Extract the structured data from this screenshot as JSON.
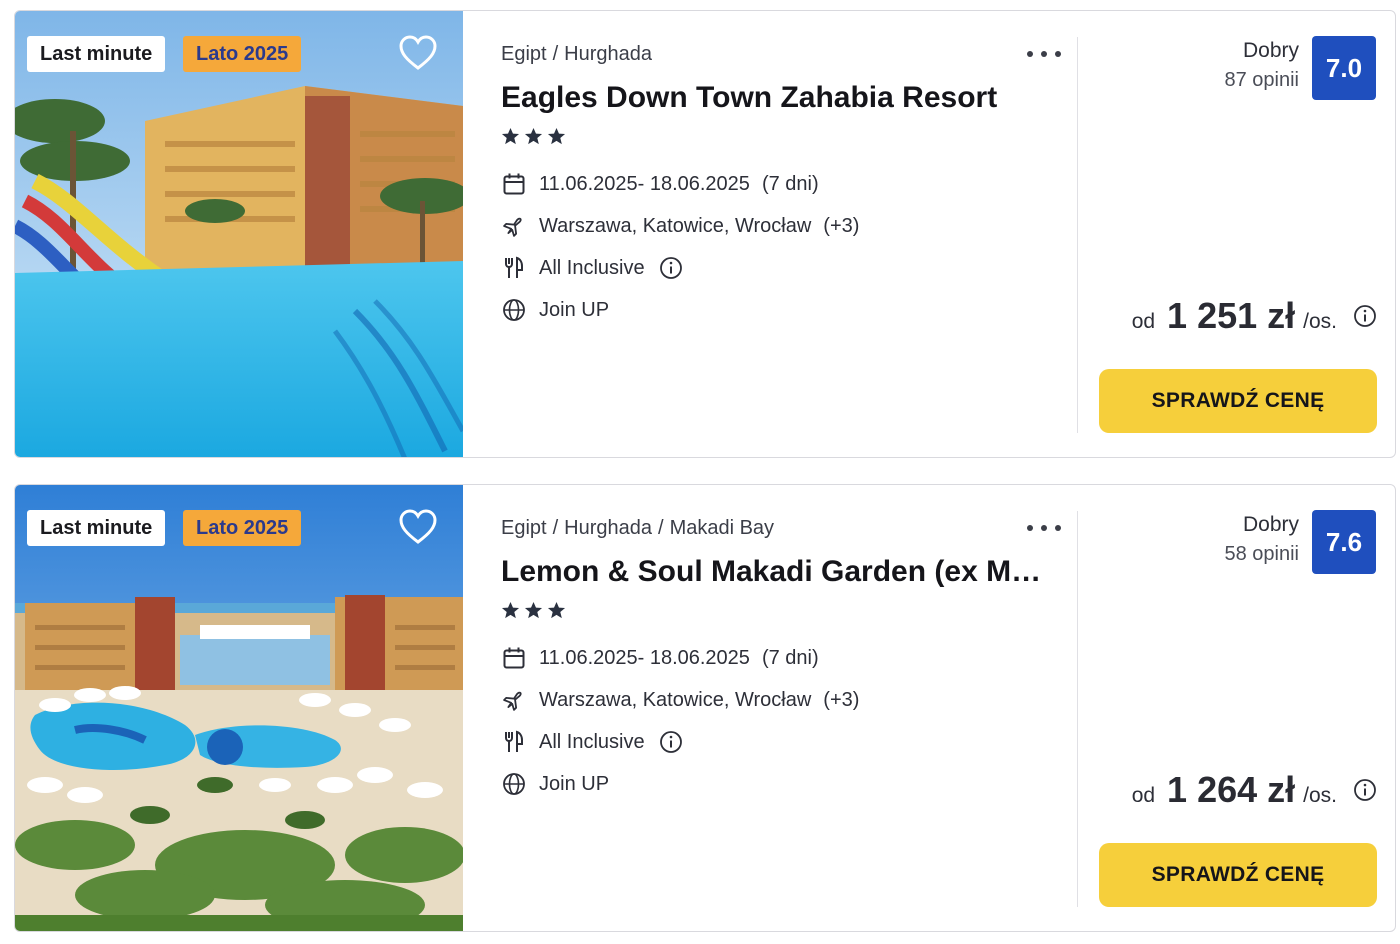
{
  "offers": [
    {
      "badge_left": "Last minute",
      "badge_season": "Lato 2025",
      "breadcrumb": [
        "Egipt",
        "Hurghada"
      ],
      "title": "Eagles Down Town Zahabia Resort",
      "stars": 3,
      "dates": "11.06.2025- 18.06.2025",
      "duration": "(7 dni)",
      "departures": "Warszawa, Katowice, Wrocław",
      "departures_more": "(+3)",
      "board": "All Inclusive",
      "operator": "Join UP",
      "rating_word": "Dobry",
      "rating_count": "87 opinii",
      "score": "7.0",
      "price_prefix": "od",
      "price": "1 251 zł",
      "price_suffix": "/os.",
      "cta": "SPRAWDŹ CENĘ"
    },
    {
      "badge_left": "Last minute",
      "badge_season": "Lato 2025",
      "breadcrumb": [
        "Egipt",
        "Hurghada",
        "Makadi Bay"
      ],
      "title": "Lemon & Soul Makadi Garden (ex Makadi Garden Azur)",
      "stars": 3,
      "dates": "11.06.2025- 18.06.2025",
      "duration": "(7 dni)",
      "departures": "Warszawa, Katowice, Wrocław",
      "departures_more": "(+3)",
      "board": "All Inclusive",
      "operator": "Join UP",
      "rating_word": "Dobry",
      "rating_count": "58 opinii",
      "score": "7.6",
      "price_prefix": "od",
      "price": "1 264 zł",
      "price_suffix": "/os.",
      "cta": "SPRAWDŹ CENĘ"
    }
  ],
  "colors": {
    "score_bg": "#1f4fbe",
    "cta_bg": "#f6cf3b",
    "season_badge_bg": "#f5a83a",
    "season_badge_text": "#2b3a8c"
  },
  "icons": [
    "heart-outline-icon",
    "more-dots-icon",
    "star-icon",
    "calendar-icon",
    "plane-icon",
    "cutlery-icon",
    "info-icon",
    "globe-icon"
  ]
}
